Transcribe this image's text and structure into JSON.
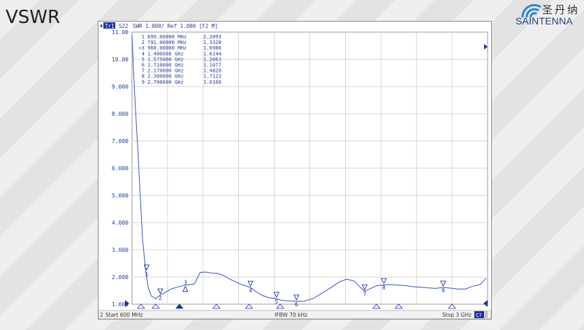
{
  "page": {
    "title": "VSWR",
    "logo": {
      "cn": "圣丹纳",
      "brand": "SAINTENNA"
    }
  },
  "colors": {
    "trace": "#3a4fc8",
    "grid": "#c8c8c8",
    "marker": "#1c2fa8",
    "text": "#2a3d9a"
  },
  "chart_data": {
    "type": "line",
    "header": {
      "trace_tab": "Tr1",
      "measurement": "S22",
      "format": "SWR 1.000/ Ref 1.000 [F2 M]"
    },
    "footer": {
      "channel": "2",
      "start": "Start 600 MHz",
      "ifbw": "IFBW 70 kHz",
      "stop": "Stop 3 GHz",
      "corner_tag": "C?"
    },
    "xlim": [
      600,
      3000
    ],
    "ylim": [
      1.0,
      11.0
    ],
    "y_ticks": [
      "11.00",
      "10.00",
      "9.000",
      "8.000",
      "7.000",
      "6.000",
      "5.000",
      "4.000",
      "3.000",
      "2.000",
      "1.000"
    ],
    "marker_table": [
      {
        "id": "1",
        "freq": "699.00000 MHz",
        "value": "2.2093"
      },
      {
        "id": "2",
        "freq": "791.00000 MHz",
        "value": "1.3328"
      },
      {
        "id": ">3",
        "freq": "960.00000 MHz",
        "value": "1.6986"
      },
      {
        "id": "4",
        "freq": "1.400000 GHz",
        "value": "1.6144"
      },
      {
        "id": "5",
        "freq": "1.575000 GHz",
        "value": "1.2063"
      },
      {
        "id": "6",
        "freq": "1.710000 GHz",
        "value": "1.1077"
      },
      {
        "id": "7",
        "freq": "2.170000 GHz",
        "value": "1.4820"
      },
      {
        "id": "8",
        "freq": "2.300000 GHz",
        "value": "1.7122"
      },
      {
        "id": "9",
        "freq": "2.700000 GHz",
        "value": "1.6168"
      }
    ],
    "markers": [
      {
        "label": "1",
        "x": 699,
        "y": 2.209
      },
      {
        "label": "2",
        "x": 791,
        "y": 1.333
      },
      {
        "label": "3",
        "x": 960,
        "y": 1.699
      },
      {
        "label": "4",
        "x": 1400,
        "y": 1.614
      },
      {
        "label": "5",
        "x": 1575,
        "y": 1.206
      },
      {
        "label": "6",
        "x": 1710,
        "y": 1.108
      },
      {
        "label": "7",
        "x": 2170,
        "y": 1.482
      },
      {
        "label": "8",
        "x": 2300,
        "y": 1.712
      },
      {
        "label": "9",
        "x": 2700,
        "y": 1.617
      }
    ],
    "series": [
      {
        "x": [
          600,
          610,
          625,
          640,
          655,
          670,
          690,
          710,
          730,
          760,
          790,
          820,
          860,
          900,
          930,
          960,
          990,
          1020,
          1060,
          1100,
          1140,
          1180,
          1220,
          1260,
          1300,
          1340,
          1380,
          1400,
          1440,
          1480,
          1520,
          1575,
          1600,
          1650,
          1710,
          1760,
          1820,
          1880,
          1940,
          2000,
          2050,
          2100,
          2140,
          2170,
          2200,
          2250,
          2300,
          2350,
          2400,
          2450,
          2500,
          2550,
          2600,
          2650,
          2700,
          2750,
          2800,
          2850,
          2900,
          2950,
          2990
        ],
        "y": [
          10.9,
          9.6,
          8.0,
          6.6,
          5.0,
          3.5,
          2.3,
          1.6,
          1.3,
          1.2,
          1.33,
          1.42,
          1.55,
          1.62,
          1.66,
          1.7,
          1.72,
          1.74,
          2.17,
          2.18,
          2.14,
          2.13,
          2.05,
          1.92,
          1.82,
          1.72,
          1.65,
          1.614,
          1.45,
          1.32,
          1.24,
          1.206,
          1.15,
          1.12,
          1.108,
          1.11,
          1.2,
          1.4,
          1.6,
          1.82,
          1.92,
          1.85,
          1.62,
          1.48,
          1.55,
          1.68,
          1.712,
          1.72,
          1.7,
          1.68,
          1.64,
          1.62,
          1.6,
          1.58,
          1.617,
          1.59,
          1.56,
          1.56,
          1.66,
          1.72,
          1.96
        ]
      }
    ],
    "x_axis_triangles": [
      660,
      760,
      1170,
      1390,
      1600,
      2250,
      2400,
      2760
    ],
    "x_axis_active_triangle": 920
  }
}
